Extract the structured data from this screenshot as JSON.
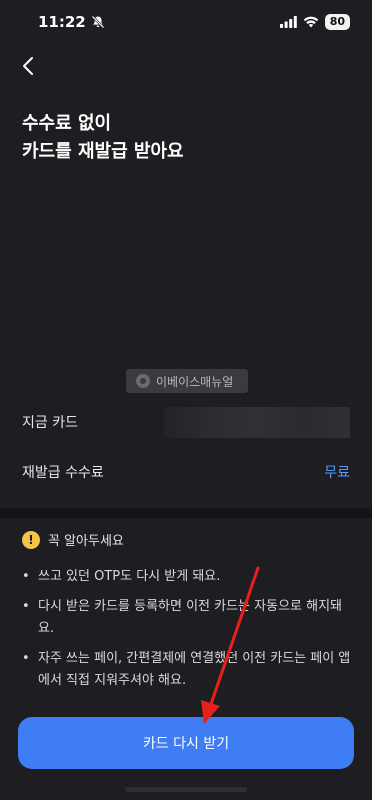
{
  "status_bar": {
    "time": "11:22",
    "battery": "80"
  },
  "title": {
    "line1": "수수료 없이",
    "line2": "카드를 재발급 받아요"
  },
  "watermark": {
    "text": "이베이스매뉴얼"
  },
  "rows": {
    "current_card_label": "지금 카드",
    "fee_label": "재발급 수수료",
    "fee_value": "무료"
  },
  "notice": {
    "heading": "꼭 알아두세요",
    "items": [
      "쓰고 있던 OTP도 다시 받게 돼요.",
      "다시 받은 카드를 등록하면 이전 카드는 자동으로 해지돼요.",
      "자주 쓰는 페이, 간편결제에 연결했던 이전 카드는 페이 앱에서 직접 지워주셔야 해요."
    ]
  },
  "cta": {
    "label": "카드 다시 받기"
  },
  "colors": {
    "background": "#1e1e22",
    "accent": "#3f7df5",
    "link": "#5c9bff",
    "warning": "#f5c24a",
    "annotation_arrow": "#e8201a"
  }
}
